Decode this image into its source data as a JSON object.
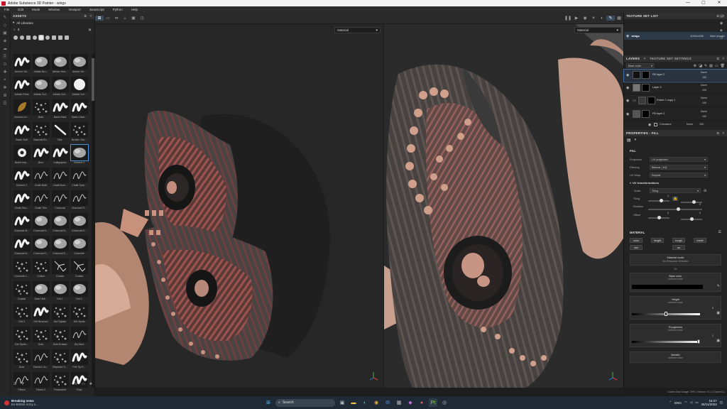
{
  "window": {
    "title": "Adobe Substance 3D Painter - wings",
    "min": "—",
    "max": "▢",
    "close": "✕"
  },
  "menu": [
    "File",
    "Edit",
    "Mode",
    "Window",
    "Viewport",
    "JavaScript",
    "Python",
    "Help"
  ],
  "assets": {
    "title": "ASSETS",
    "library": "All Libraries",
    "search_value": "s",
    "items": [
      "Archive Mi...",
      "Artistic Bru...",
      "Artistic Hea...",
      "Artistic He...",
      "Artistic Point",
      "Artistic Sof...",
      "Artistic Sof...",
      "Artistic Sof...",
      "Autumn Le...",
      "Bark",
      "Basic Hard",
      "Basic Hard...",
      "Basic Soft",
      "Basmati Br...",
      "Blur",
      "Broken Gla...",
      "Bullet Imp...",
      "Burn",
      "Calligraphic",
      "Cement 1",
      "Cement 2",
      "Chalk Bold",
      "Chalk Bum...",
      "Chalk Spre...",
      "Chalk Stro...",
      "Chalk Thin",
      "Charcoal",
      "Charcoal Fi...",
      "Charcoal M...",
      "Charcoal N...",
      "Charcoal N...",
      "Charcoal N...",
      "Charcoal N...",
      "Charcoal S...",
      "Charcoal S...",
      "Concrete",
      "Concrete L...",
      "Cotton",
      "Cracks",
      "Cracks",
      "Crystal",
      "Dark Heli...",
      "Dirt 1",
      "Dirt 2",
      "Dirt 3",
      "Dirt Brushed",
      "Dirt Splash",
      "Dirt Spots",
      "Dirt Spots...",
      "Dots",
      "Dots Erased",
      "Dry Mud",
      "Dust",
      "Electric Lin...",
      "Elephant S...",
      "Felt Tip E...",
      "Fibers",
      "Fibers 2",
      "Fingerprint",
      "Fluid"
    ],
    "selected_index": 19
  },
  "viewport": {
    "left_channel": "Material",
    "right_channel": "Material"
  },
  "texture_set_list": {
    "title": "TEXTURE SET LIST",
    "name": "wings",
    "resolution": "4096x4096",
    "shader": "Main shader"
  },
  "layers": {
    "tab1": "LAYERS",
    "tab2": "TEXTURE SET SETTINGS",
    "channel": "Base color",
    "items": [
      {
        "name": "Fill layer 2",
        "blend": "Norm",
        "opacity": "100"
      },
      {
        "name": "Layer 4",
        "blend": "Norm",
        "opacity": "100"
      },
      {
        "name": "Folder 1 copy 1",
        "blend": "Norm",
        "opacity": "100"
      },
      {
        "name": "Fill layer 2",
        "blend": "Norm",
        "opacity": "100"
      }
    ],
    "sub_effect": {
      "name": "Curvature",
      "blend": "Norm",
      "opacity": "100"
    }
  },
  "properties": {
    "title": "PROPERTIES - FILL",
    "fill_section": "FILL",
    "projection_label": "Projection",
    "projection_value": "UV projection",
    "filtering_label": "Filtering",
    "filtering_value": "Bilinear | HQ",
    "uvwrap_label": "UV Wrap",
    "uvwrap_value": "Repeat",
    "uv_section": "UV transformations",
    "scale_label": "Scale",
    "scale_value": "Tiling",
    "tiling_label": "Tiling",
    "tiling_value": "1",
    "rotation_label": "Rotation",
    "rotation_value": "0",
    "offset_label": "Offset",
    "offset_x": "0",
    "offset_y": "0",
    "material_section": "MATERIAL",
    "channels": [
      "color",
      "height",
      "rough",
      "metal",
      "nrm",
      "ao"
    ],
    "material_mode_label": "Material mode",
    "material_mode_value": "No Resource Selected",
    "or_text": "Or",
    "base_color_label": "Base color",
    "base_color_sub": "uniform color",
    "height_label": "Height",
    "height_sub": "uniform color",
    "height_value": "0",
    "roughness_label": "Roughness",
    "roughness_sub": "uniform color",
    "roughness_value": "1",
    "metallic_label": "Metallic",
    "metallic_sub": "uniform color"
  },
  "status": {
    "text": "Cache Disk Usage: 29% | Version: 9.1.1 (OpenGL)"
  },
  "taskbar": {
    "news_title": "Breaking news",
    "news_sub": "Ex-British Army s...",
    "search_placeholder": "Search",
    "lang": "ENG",
    "time": "15:27",
    "date": "26/11/2024"
  }
}
